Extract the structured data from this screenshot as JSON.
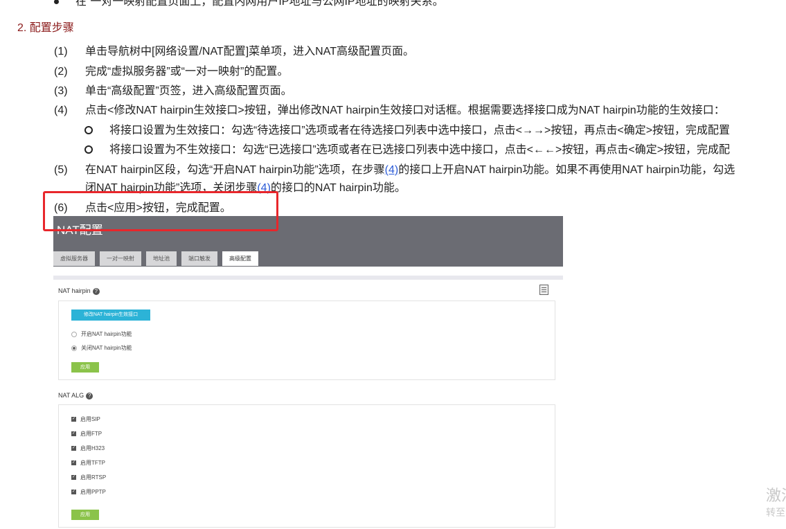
{
  "top_line": "在“一对一映射配置页面上，配置内网用户IP地址与公网IP地址的映射关系。",
  "section_title": "2. 配置步骤",
  "steps": {
    "s1": {
      "num": "(1)",
      "text": "单击导航树中[网络设置/NAT配置]菜单项，进入NAT高级配置页面。"
    },
    "s2": {
      "num": "(2)",
      "text": "完成“虚拟服务器”或“一对一映射”的配置。"
    },
    "s3": {
      "num": "(3)",
      "text": "单击“高级配置”页签，进入高级配置页面。"
    },
    "s4": {
      "num": "(4)",
      "text": "点击<修改NAT hairpin生效接口>按钮，弹出修改NAT hairpin生效接口对话框。根据需要选择接口成为NAT hairpin功能的生效接口："
    },
    "s4a": "将接口设置为生效接口：勾选“待选接口”选项或者在待选接口列表中选中接口，点击<→→>按钮，再点击<确定>按钮，完成配置",
    "s4b": "将接口设置为不生效接口：勾选“已选接口”选项或者在已选接口列表中选中接口，点击<←←>按钮，再点击<确定>按钮，完成配",
    "s5": {
      "num": "(5)",
      "pre": "在NAT hairpin区段，勾选“开启NAT hairpin功能”选项，在步骤",
      "link": "(4)",
      "post": "的接口上开启NAT hairpin功能。如果不再使用NAT hairpin功能，勾选"
    },
    "s5b": {
      "pre": "闭NAT hairpin功能”选项，关闭步骤",
      "link": "(4)",
      "post": "的接口的NAT hairpin功能。"
    },
    "s6": {
      "num": "(6)",
      "text": "点击<应用>按钮，完成配置。"
    }
  },
  "shot": {
    "title": "NAT配置",
    "tabs": [
      "虚拟服务器",
      "一对一映射",
      "地址池",
      "端口触发",
      "高级配置"
    ],
    "hairpin_label": "NAT hairpin",
    "modify_btn": "修改NAT hairpin生效接口",
    "radio_on": "开启NAT hairpin功能",
    "radio_off": "关闭NAT hairpin功能",
    "apply": "应用",
    "alg_label": "NAT ALG",
    "alg_items": [
      "启用SIP",
      "启用FTP",
      "启用H323",
      "启用TFTP",
      "启用RTSP",
      "启用PPTP"
    ]
  },
  "watermark": {
    "line1": "激活",
    "line2": "转至"
  }
}
